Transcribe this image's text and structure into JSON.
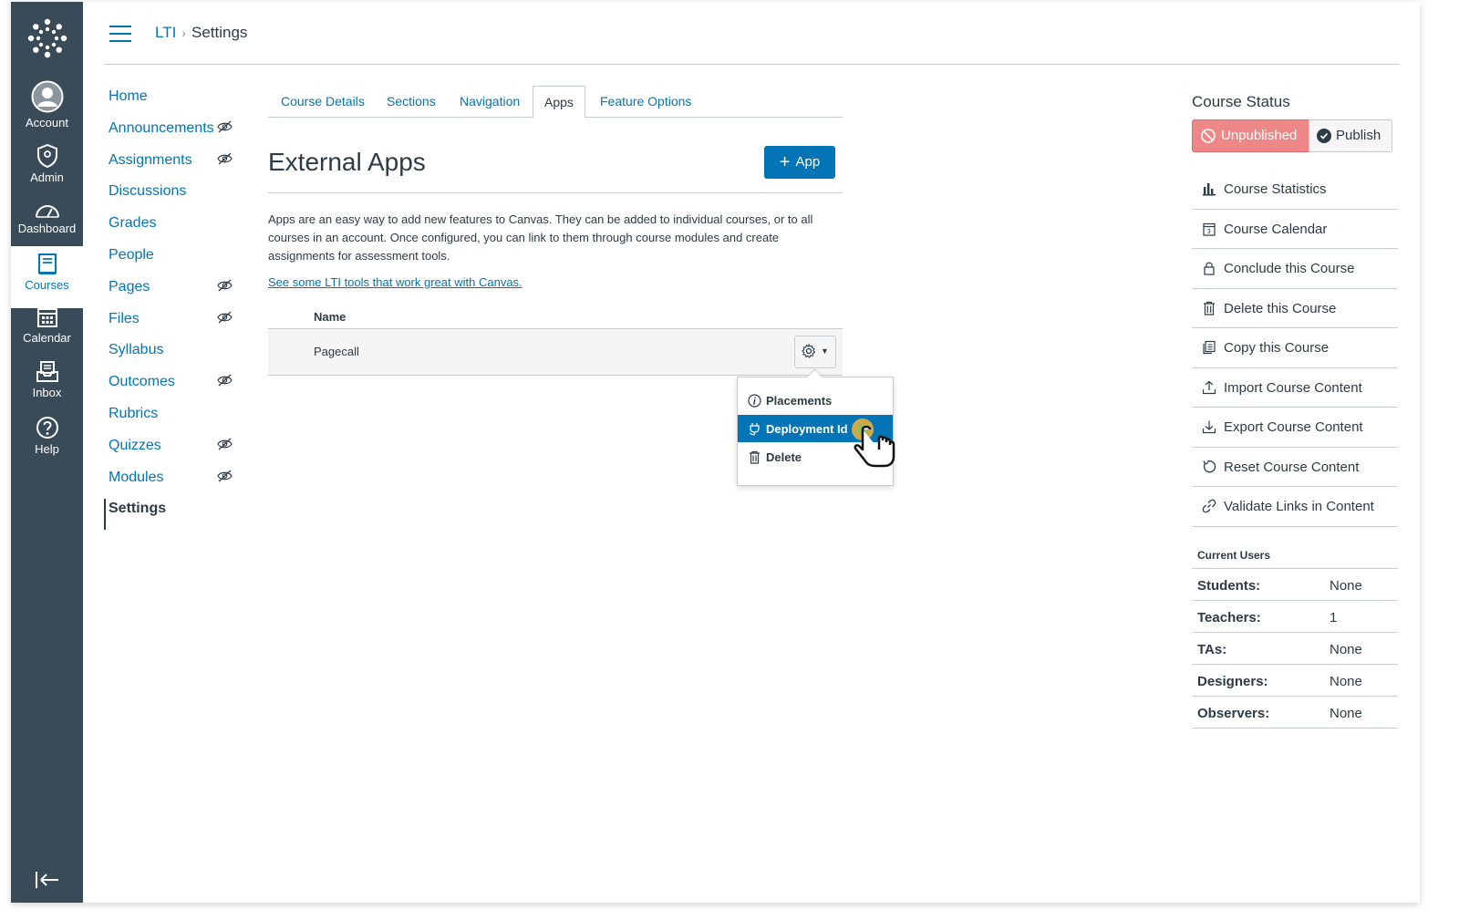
{
  "global_nav": {
    "items": [
      {
        "label": "Account",
        "icon": "account-icon"
      },
      {
        "label": "Admin",
        "icon": "admin-shield-icon"
      },
      {
        "label": "Dashboard",
        "icon": "dashboard-gauge-icon"
      },
      {
        "label": "Courses",
        "icon": "courses-book-icon",
        "active": true
      },
      {
        "label": "Calendar",
        "icon": "calendar-icon"
      },
      {
        "label": "Inbox",
        "icon": "inbox-icon"
      },
      {
        "label": "Help",
        "icon": "help-icon"
      }
    ],
    "bg_color": "#394b58"
  },
  "breadcrumb": {
    "course": "LTI",
    "page": "Settings"
  },
  "course_nav": {
    "items": [
      {
        "label": "Home",
        "hidden": false
      },
      {
        "label": "Announcements",
        "hidden": true
      },
      {
        "label": "Assignments",
        "hidden": true
      },
      {
        "label": "Discussions",
        "hidden": false
      },
      {
        "label": "Grades",
        "hidden": false
      },
      {
        "label": "People",
        "hidden": false
      },
      {
        "label": "Pages",
        "hidden": true
      },
      {
        "label": "Files",
        "hidden": true
      },
      {
        "label": "Syllabus",
        "hidden": false
      },
      {
        "label": "Outcomes",
        "hidden": true
      },
      {
        "label": "Rubrics",
        "hidden": false
      },
      {
        "label": "Quizzes",
        "hidden": true
      },
      {
        "label": "Modules",
        "hidden": true
      },
      {
        "label": "Settings",
        "hidden": false,
        "active": true
      }
    ]
  },
  "tabs": [
    "Course Details",
    "Sections",
    "Navigation",
    "Apps",
    "Feature Options"
  ],
  "active_tab": "Apps",
  "main": {
    "title": "External Apps",
    "add_button": "App",
    "description": "Apps are an easy way to add new features to Canvas. They can be added to individual courses, or to all courses in an account. Once configured, you can link to them through course modules and create assignments for assessment tools.",
    "link": "See some LTI tools that work great with Canvas.",
    "table": {
      "header": "Name",
      "rows": [
        {
          "name": "Pagecall"
        }
      ]
    },
    "menu": {
      "items": [
        {
          "label": "Placements",
          "icon": "info-icon"
        },
        {
          "label": "Deployment Id",
          "icon": "plug-icon",
          "selected": true
        },
        {
          "label": "Delete",
          "icon": "trash-icon"
        }
      ]
    }
  },
  "sidebar_right": {
    "status_title": "Course Status",
    "unpublished": "Unpublished",
    "publish": "Publish",
    "actions": [
      {
        "label": "Course Statistics",
        "icon": "bar-chart-icon"
      },
      {
        "label": "Course Calendar",
        "icon": "calendar-icon"
      },
      {
        "label": "Conclude this Course",
        "icon": "lock-icon"
      },
      {
        "label": "Delete this Course",
        "icon": "trash-icon"
      },
      {
        "label": "Copy this Course",
        "icon": "copy-icon"
      },
      {
        "label": "Import Course Content",
        "icon": "upload-icon"
      },
      {
        "label": "Export Course Content",
        "icon": "download-icon"
      },
      {
        "label": "Reset Course Content",
        "icon": "reset-icon"
      },
      {
        "label": "Validate Links in Content",
        "icon": "link-icon"
      }
    ],
    "current_users_title": "Current Users",
    "users": [
      {
        "role": "Students:",
        "count": "None"
      },
      {
        "role": "Teachers:",
        "count": "1"
      },
      {
        "role": "TAs:",
        "count": "None"
      },
      {
        "role": "Designers:",
        "count": "None"
      },
      {
        "role": "Observers:",
        "count": "None"
      }
    ]
  },
  "colors": {
    "link": "#0374b5",
    "unpublished": "#ee8787",
    "text": "#2d3b45"
  }
}
